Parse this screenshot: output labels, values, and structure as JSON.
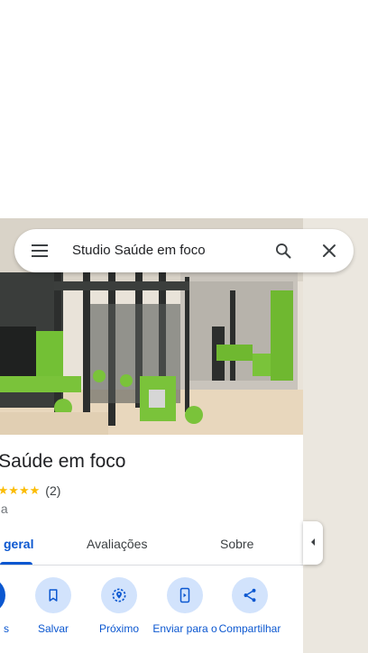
{
  "search": {
    "query": "Studio Saúde em foco"
  },
  "place": {
    "title": "io Saúde em foco",
    "stars": "★★★★★",
    "review_count": "(2)",
    "category": "nia"
  },
  "tabs": [
    {
      "label": "geral"
    },
    {
      "label": "Avaliações"
    },
    {
      "label": "Sobre"
    }
  ],
  "actions": [
    {
      "label": "s",
      "icon": "directions-icon"
    },
    {
      "label": "Salvar",
      "icon": "bookmark-icon"
    },
    {
      "label": "Próximo",
      "icon": "nearby-icon"
    },
    {
      "label": "Enviar para o",
      "icon": "send-to-phone-icon"
    },
    {
      "label": "Compartilhar",
      "icon": "share-icon"
    }
  ],
  "colors": {
    "accent": "#0b57d0",
    "action_bg": "#d2e3fc",
    "star": "#fbbc04",
    "map_bg": "#ebe7df"
  }
}
